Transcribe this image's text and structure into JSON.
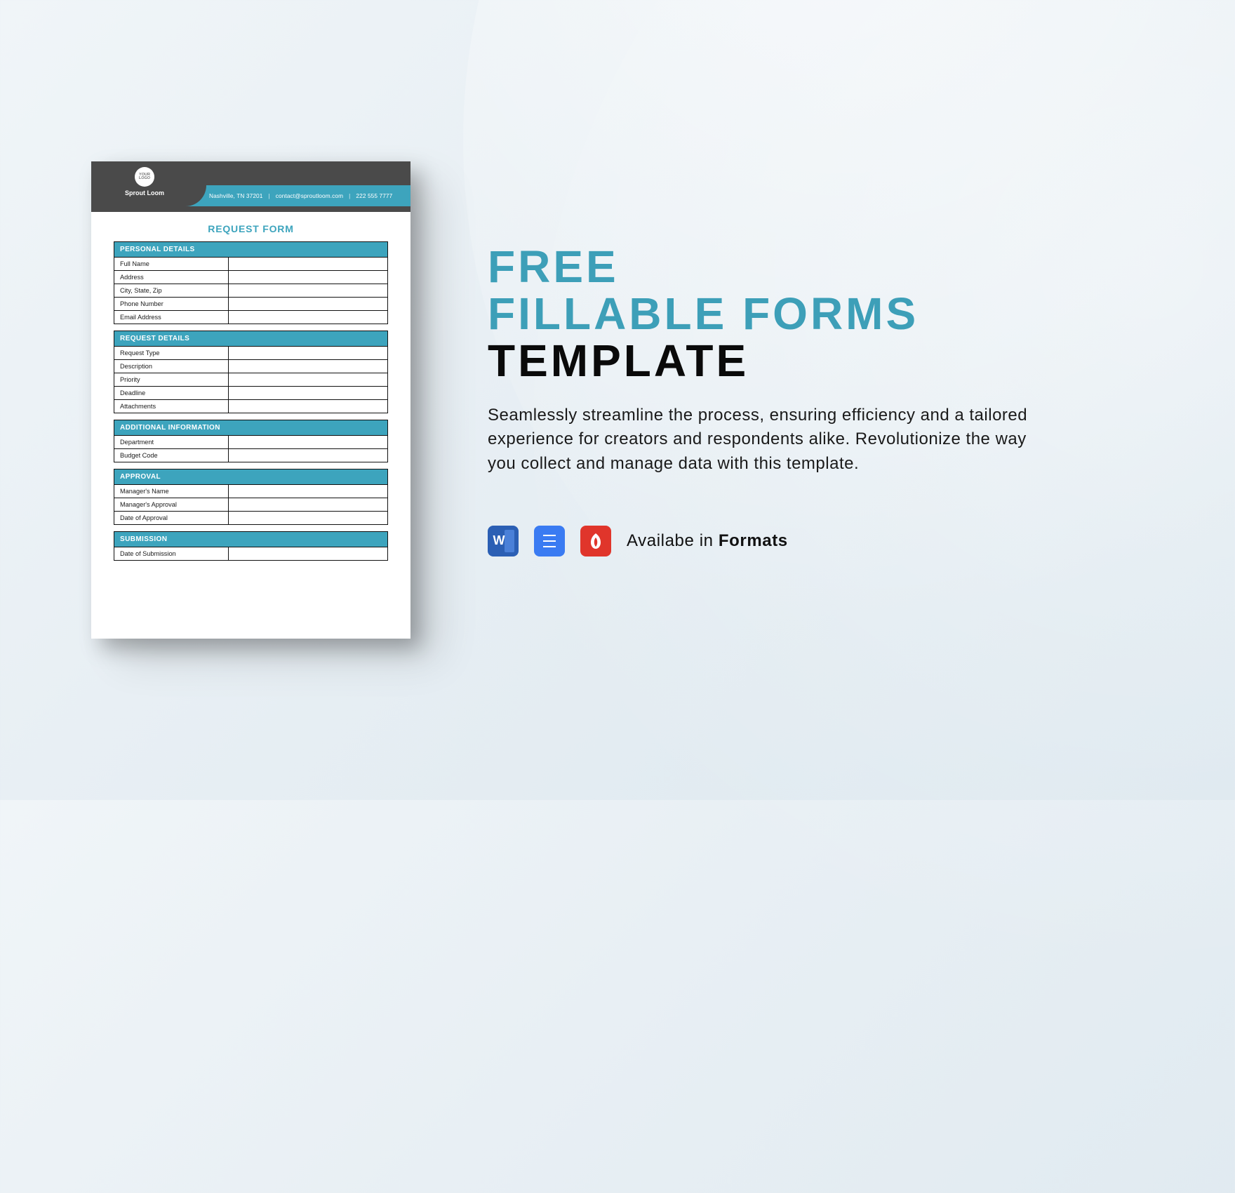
{
  "background": {
    "accent": "#3da4bd",
    "dark": "#0a0a0a"
  },
  "doc": {
    "company": "Sprout Loom",
    "logo_text": "YOUR\nLOGO",
    "contact": {
      "address": "Nashville, TN 37201",
      "email": "contact@sproutloom.com",
      "phone": "222 555 7777"
    },
    "title": "REQUEST FORM",
    "sections": [
      {
        "name": "PERSONAL DETAILS",
        "rows": [
          "Full Name",
          "Address",
          "City, State, Zip",
          "Phone Number",
          "Email Address"
        ]
      },
      {
        "name": "REQUEST DETAILS",
        "rows": [
          "Request Type",
          "Description",
          "Priority",
          "Deadline",
          "Attachments"
        ]
      },
      {
        "name": "ADDITIONAL INFORMATION",
        "rows": [
          "Department",
          "Budget Code"
        ]
      },
      {
        "name": "APPROVAL",
        "rows": [
          "Manager's Name",
          "Manager's Approval",
          "Date of Approval"
        ]
      },
      {
        "name": "SUBMISSION",
        "rows": [
          "Date of Submission"
        ]
      }
    ]
  },
  "headline": {
    "line1": "FREE",
    "line2": "FILLABLE FORMS",
    "line3": "TEMPLATE"
  },
  "description": "Seamlessly streamline the process, ensuring efficiency and a tailored experience for creators and respondents alike. Revolutionize the way you collect and manage data with this template.",
  "formats": {
    "label_prefix": "Availabe in ",
    "label_bold": "Formats",
    "icons": [
      {
        "name": "word-icon",
        "glyph": "W"
      },
      {
        "name": "google-docs-icon",
        "glyph": ""
      },
      {
        "name": "pdf-icon",
        "glyph": ""
      }
    ]
  }
}
